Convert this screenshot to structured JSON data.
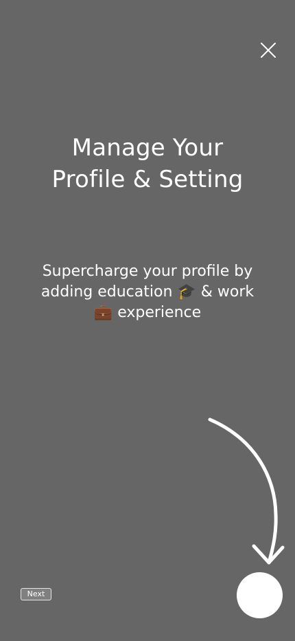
{
  "onboarding": {
    "close_icon": "close-icon",
    "title_line1": "Manage Your",
    "title_line2": "Profile & Setting",
    "description_line1": "Supercharge your profile by",
    "description_line2": "adding education 🎓 & work",
    "description_line3": "💼 experience",
    "arrow_icon": "curved-arrow-down-icon",
    "next_label": "Next",
    "colors": {
      "overlay": "#666666",
      "foreground": "#ffffff",
      "next_button_bg": "#808080"
    }
  }
}
